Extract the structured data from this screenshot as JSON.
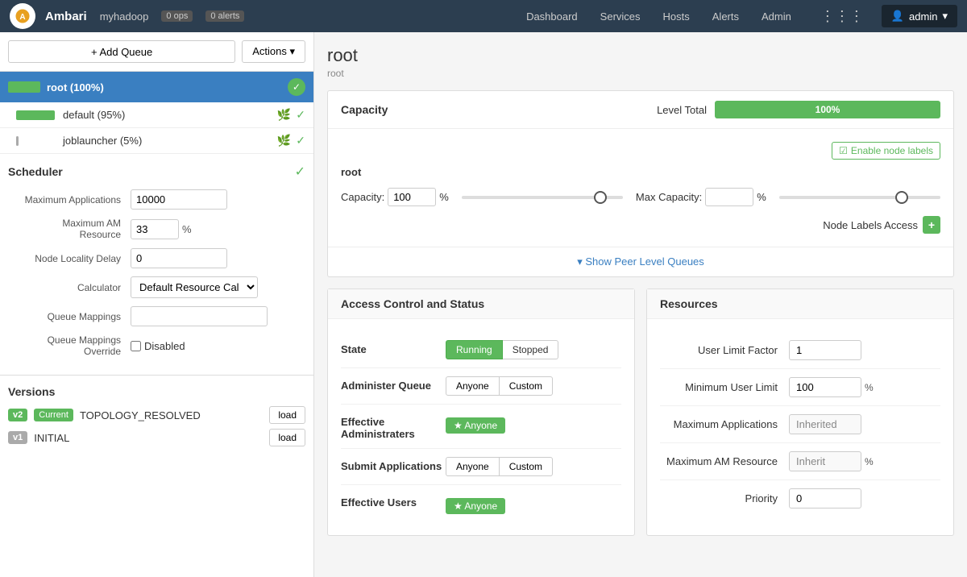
{
  "nav": {
    "logo_text": "A",
    "app_name": "Ambari",
    "cluster": "myhadoop",
    "ops_badge": "0 ops",
    "alerts_badge": "0 alerts",
    "links": [
      "Dashboard",
      "Services",
      "Hosts",
      "Alerts",
      "Admin"
    ],
    "user": "admin"
  },
  "left": {
    "add_queue_label": "+ Add Queue",
    "actions_label": "Actions ▾",
    "queues": [
      {
        "id": "root",
        "label": "root (100%)",
        "bar_pct": 100,
        "checked": true,
        "level": "root"
      },
      {
        "id": "default",
        "label": "default (95%)",
        "bar_pct": 95,
        "checked": true,
        "level": "child"
      },
      {
        "id": "joblauncher",
        "label": "joblauncher (5%)",
        "bar_pct": 5,
        "checked": true,
        "level": "child"
      }
    ],
    "scheduler": {
      "title": "Scheduler",
      "fields": [
        {
          "label": "Maximum Applications",
          "value": "10000",
          "type": "text",
          "size": "md"
        },
        {
          "label": "Maximum AM Resource",
          "value": "33",
          "type": "text",
          "size": "sm",
          "unit": "%"
        },
        {
          "label": "Node Locality Delay",
          "value": "0",
          "type": "text",
          "size": "md"
        },
        {
          "label": "Calculator",
          "value": "Default Resource Cal",
          "type": "select"
        },
        {
          "label": "Queue Mappings",
          "value": "",
          "type": "text",
          "size": "lg"
        },
        {
          "label": "Queue Mappings Override",
          "value": "Disabled",
          "type": "checkbox"
        }
      ]
    },
    "versions": {
      "title": "Versions",
      "items": [
        {
          "badge": "v2",
          "is_current": true,
          "current_label": "Current",
          "name": "TOPOLOGY_RESOLVED",
          "load_label": "load"
        },
        {
          "badge": "v1",
          "is_current": false,
          "name": "INITIAL",
          "load_label": "load"
        }
      ]
    }
  },
  "right": {
    "title": "root",
    "breadcrumb": "root",
    "capacity": {
      "title": "Capacity",
      "level_total_label": "Level Total",
      "level_total_pct": "100%",
      "level_total_value": 100,
      "enable_node_labels": "Enable node labels",
      "root_label": "root",
      "capacity_label": "Capacity:",
      "capacity_value": "100",
      "capacity_unit": "%",
      "max_capacity_label": "Max Capacity:",
      "max_capacity_value": "",
      "max_capacity_unit": "%",
      "capacity_slider_pct": 85,
      "max_slider_pct": 75,
      "node_labels_access_label": "Node Labels Access",
      "show_peer_queues": "▾ Show Peer Level Queues"
    },
    "access_control": {
      "title": "Access Control and Status",
      "state_label": "State",
      "state_running": "Running",
      "state_stopped": "Stopped",
      "administer_label": "Administer Queue",
      "administer_anyone": "Anyone",
      "administer_custom": "Custom",
      "effective_admin_label": "Effective Administraters",
      "effective_admin_tag": "★ Anyone",
      "submit_label": "Submit Applications",
      "submit_anyone": "Anyone",
      "submit_custom": "Custom",
      "effective_users_label": "Effective Users",
      "effective_users_tag": "★ Anyone"
    },
    "resources": {
      "title": "Resources",
      "fields": [
        {
          "label": "User Limit Factor",
          "value": "1",
          "unit": "",
          "inherited": false
        },
        {
          "label": "Minimum User Limit",
          "value": "100",
          "unit": "%",
          "inherited": false
        },
        {
          "label": "Maximum Applications",
          "value": "Inherited",
          "unit": "",
          "inherited": true
        },
        {
          "label": "Maximum AM Resource",
          "value": "Inherit",
          "unit": "%",
          "inherited": true
        },
        {
          "label": "Priority",
          "value": "0",
          "unit": "",
          "inherited": false
        }
      ]
    }
  }
}
